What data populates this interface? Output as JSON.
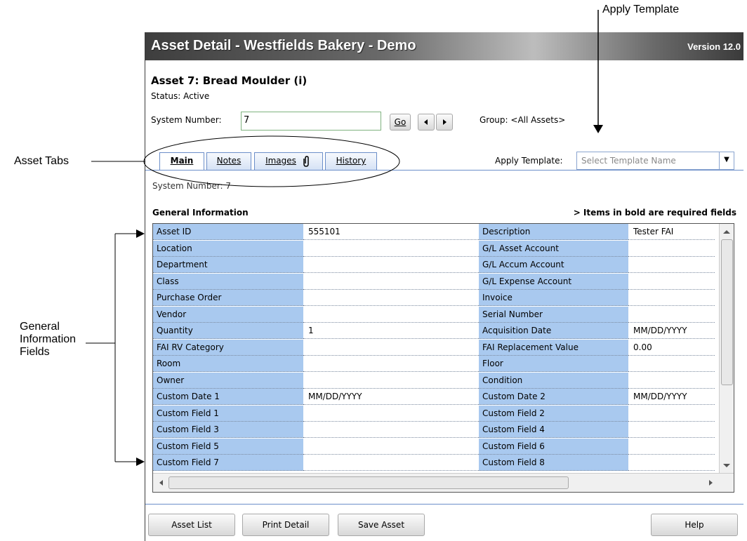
{
  "annotations": {
    "apply_template": "Apply Template",
    "asset_tabs": "Asset Tabs",
    "general_info_line1": "General",
    "general_info_line2": "Information",
    "general_info_line3": "Fields"
  },
  "window": {
    "title": "Asset Detail - Westfields Bakery - Demo",
    "version": "Version 12.0"
  },
  "asset": {
    "title": "Asset 7: Bread  Moulder (i)",
    "status": "Status: Active"
  },
  "system_number": {
    "label": "System Number:",
    "value": "7",
    "go_label": "Go",
    "group": "Group: <All Assets>"
  },
  "tabs": [
    {
      "label": "Main",
      "active": true
    },
    {
      "label": "Notes",
      "active": false
    },
    {
      "label": "Images",
      "active": false,
      "icon": "paperclip-icon"
    },
    {
      "label": "History",
      "active": false
    }
  ],
  "template": {
    "label": "Apply Template:",
    "placeholder": "Select Template Name"
  },
  "system_number_display": "System Number:   7",
  "general_info": {
    "header": "General Information",
    "required_note": "> Items in bold are required fields",
    "rows": [
      {
        "l1": "Asset ID",
        "v1": "555101",
        "l2": "Description",
        "v2": "Tester FAI"
      },
      {
        "l1": "Location",
        "v1": "",
        "l2": "G/L Asset Account",
        "v2": ""
      },
      {
        "l1": "Department",
        "v1": "",
        "l2": "G/L Accum Account",
        "v2": ""
      },
      {
        "l1": "Class",
        "v1": "",
        "l2": "G/L Expense Account",
        "v2": ""
      },
      {
        "l1": "Purchase Order",
        "v1": "",
        "l2": "Invoice",
        "v2": ""
      },
      {
        "l1": "Vendor",
        "v1": "",
        "l2": "Serial Number",
        "v2": ""
      },
      {
        "l1": "Quantity",
        "v1": "1",
        "l2": "Acquisition Date",
        "v2": "MM/DD/YYYY"
      },
      {
        "l1": "FAI RV Category",
        "v1": "",
        "l2": "FAI Replacement Value",
        "v2": "0.00"
      },
      {
        "l1": "Room",
        "v1": "",
        "l2": "Floor",
        "v2": ""
      },
      {
        "l1": "Owner",
        "v1": "",
        "l2": "Condition",
        "v2": ""
      },
      {
        "l1": "Custom Date 1",
        "v1": "MM/DD/YYYY",
        "l2": "Custom Date 2",
        "v2": "MM/DD/YYYY"
      },
      {
        "l1": "Custom Field  1",
        "v1": "",
        "l2": "Custom Field  2",
        "v2": ""
      },
      {
        "l1": "Custom Field  3",
        "v1": "",
        "l2": "Custom Field  4",
        "v2": ""
      },
      {
        "l1": "Custom Field  5",
        "v1": "",
        "l2": "Custom Field  6",
        "v2": ""
      },
      {
        "l1": "Custom Field  7",
        "v1": "",
        "l2": "Custom Field  8",
        "v2": ""
      }
    ]
  },
  "footer": {
    "asset_list": "Asset List",
    "print_detail": "Print Detail",
    "save_asset": "Save Asset",
    "help": "Help"
  }
}
